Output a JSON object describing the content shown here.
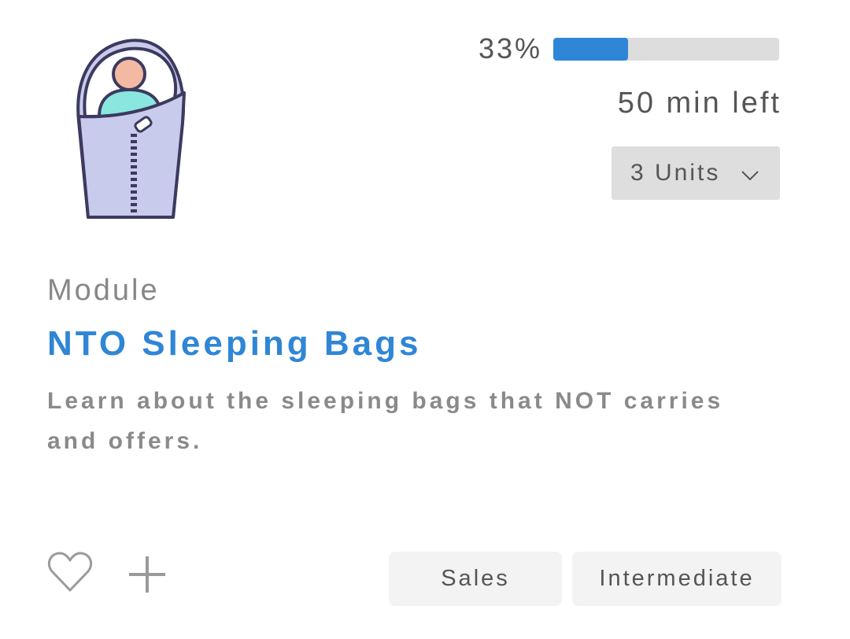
{
  "icon": "sleeping-bag-icon",
  "progress": {
    "percent_label": "33%",
    "fraction": 0.33,
    "time_left": "50 min left",
    "accent": "#2f86d6"
  },
  "units_select": {
    "label": "3 Units"
  },
  "module": {
    "type_label": "Module",
    "title": "NTO Sleeping Bags",
    "description": "Learn about the sleeping bags that NOT carries and offers."
  },
  "actions": {
    "favorite_icon": "heart-icon",
    "add_icon": "plus-icon"
  },
  "tags": [
    "Sales",
    "Intermediate"
  ]
}
